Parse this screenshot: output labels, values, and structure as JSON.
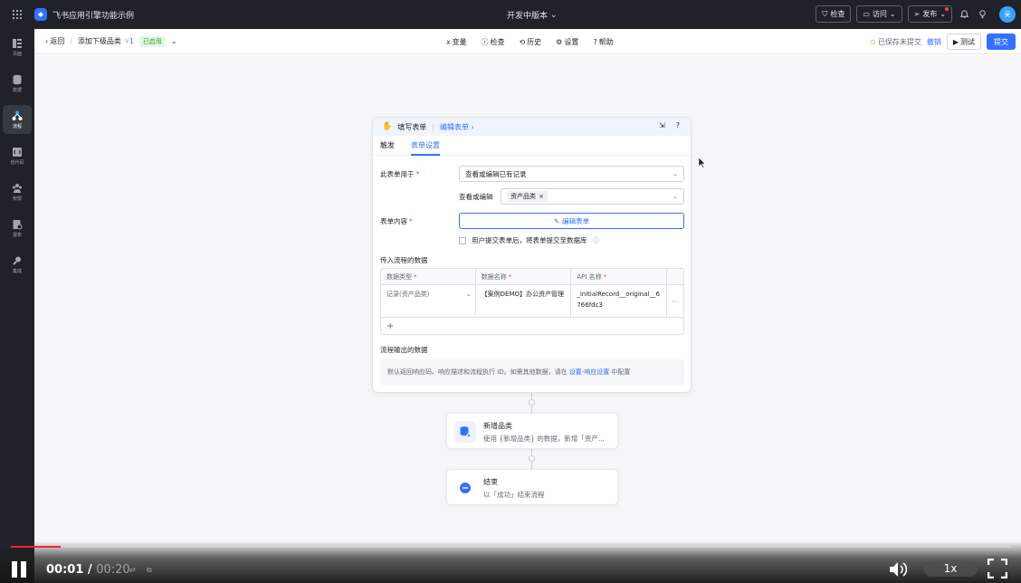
{
  "topbar": {
    "app_title": "飞书应用引擎功能示例",
    "version": "开发中版本",
    "check": "检查",
    "visit": "访问",
    "publish": "发布",
    "avatar_text": "吴"
  },
  "sidebar": {
    "items": [
      {
        "label": "页面",
        "icon": "pages-icon"
      },
      {
        "label": "数据",
        "icon": "database-icon"
      },
      {
        "label": "流程",
        "icon": "flow-icon"
      },
      {
        "label": "低代码",
        "icon": "code-icon"
      },
      {
        "label": "权限",
        "icon": "permission-icon"
      },
      {
        "label": "报表",
        "icon": "report-icon"
      },
      {
        "label": "集成",
        "icon": "integration-icon"
      }
    ]
  },
  "subheader": {
    "back": "返回",
    "flow_name": "添加下级品类",
    "version_number": "1",
    "status": "已启用",
    "tools": [
      "变量",
      "检查",
      "历史",
      "设置",
      "帮助"
    ],
    "unsaved": "已保存未提交",
    "revert": "撤销",
    "test": "测试",
    "submit": "提交"
  },
  "card": {
    "title": "填写表单",
    "edit_link": "编辑表单",
    "tabs": [
      "触发",
      "表单设置"
    ],
    "form_usage_label": "此表单用于",
    "form_usage_value": "查看或编辑已有记录",
    "view_edit_label": "查看或编辑",
    "view_edit_tag": "资产品类",
    "form_content_label": "表单内容",
    "edit_form_button": "编辑表单",
    "submit_checkbox_label": "用户提交表单后，将表单提交至数据库",
    "input_data_title": "传入流程的数据",
    "table": {
      "headers": [
        "数据类型",
        "数据名称",
        "API 名称"
      ],
      "rows": [
        {
          "type": "记录(资产品类)",
          "name": "【案例DEMO】办公资产管理",
          "api": "_initialRecord__original__6766fdc3"
        }
      ],
      "add": "+"
    },
    "output_data_title": "流程输出的数据",
    "output_info_pre": "默认返回响应码、响应描述和流程执行 ID。如需其他数据，请在",
    "output_info_link": "设置-响应设置",
    "output_info_post": "中配置"
  },
  "nodes": [
    {
      "title": "新增品类",
      "desc": "使用 {新增品类} 的数据，新增「资产...",
      "icon": "database-add-icon"
    },
    {
      "title": "结束",
      "desc": "以「成功」结束流程",
      "icon": "end-icon"
    }
  ],
  "video": {
    "current": "00:01",
    "total": "00:20",
    "speed": "1x",
    "progress": 0.05
  },
  "colors": {
    "accent": "#3370ff",
    "sidebar_bg": "#1f2329",
    "progress": "#f5222d"
  }
}
